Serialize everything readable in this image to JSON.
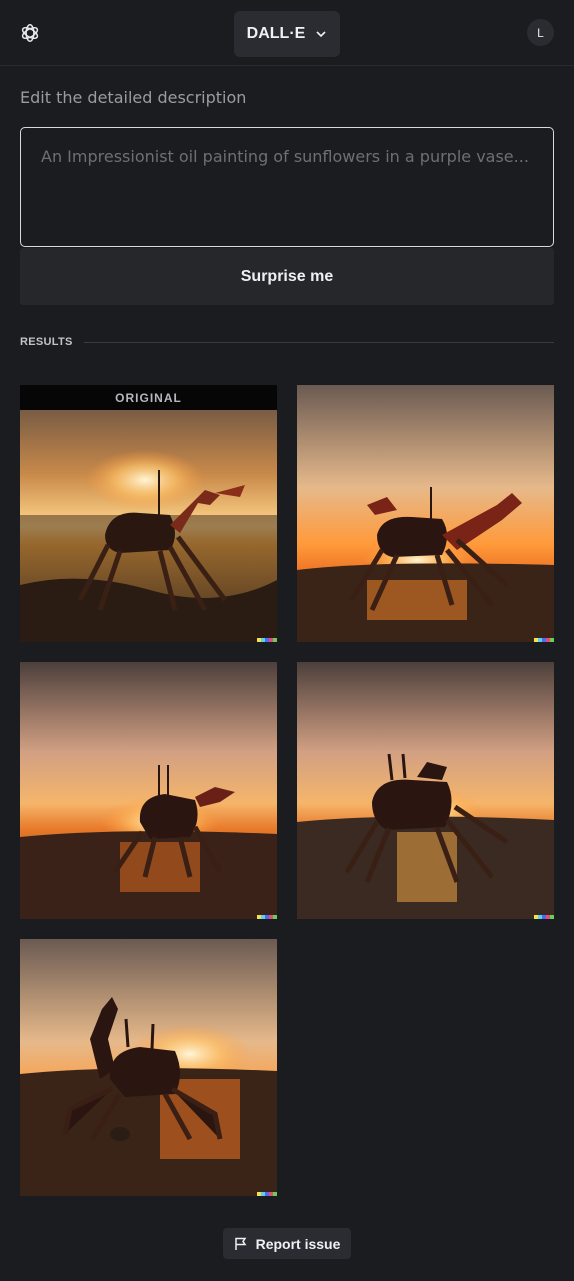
{
  "header": {
    "model_label": "DALL·E",
    "avatar_initial": "L"
  },
  "prompt": {
    "label": "Edit the detailed description",
    "value": "",
    "placeholder": "An Impressionist oil painting of sunflowers in a purple vase..."
  },
  "surprise_label": "Surprise me",
  "results": {
    "label": "RESULTS",
    "original_badge": "ORIGINAL"
  },
  "signature_colors": [
    "#f2e14c",
    "#5fd0e8",
    "#4b6cf0",
    "#e34b78",
    "#67d05a"
  ],
  "report_label": "Report issue"
}
